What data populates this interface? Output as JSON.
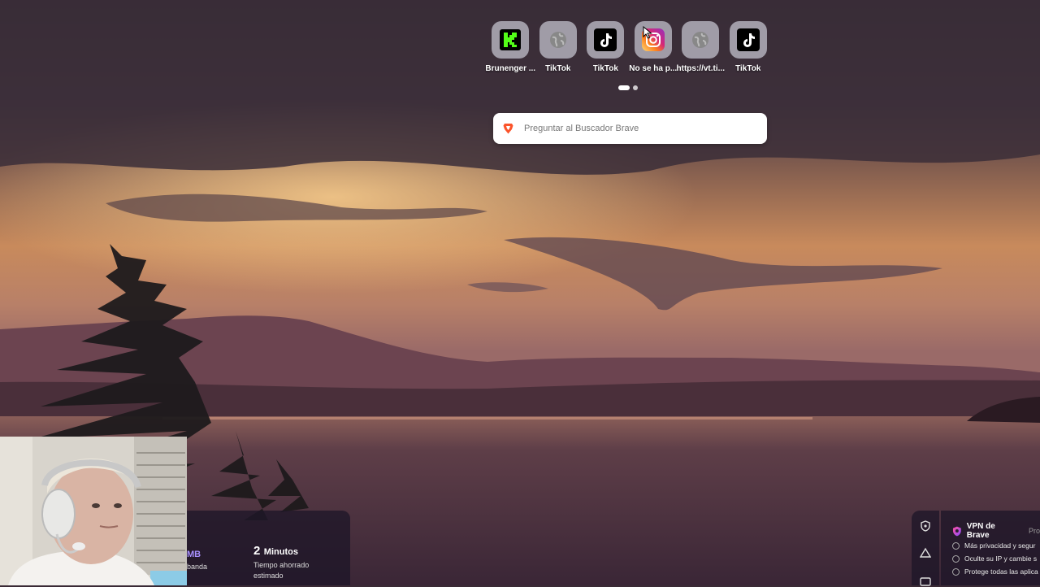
{
  "top_sites": [
    {
      "label": "Brunenger ...",
      "icon": "kick-icon"
    },
    {
      "label": "TikTok",
      "icon": "globe-icon"
    },
    {
      "label": "TikTok",
      "icon": "tiktok-icon"
    },
    {
      "label": "No se ha p...",
      "icon": "instagram-icon"
    },
    {
      "label": "https://vt.ti...",
      "icon": "globe-icon"
    },
    {
      "label": "TikTok",
      "icon": "tiktok-icon"
    }
  ],
  "search": {
    "placeholder": "Preguntar al Buscador Brave"
  },
  "stats": {
    "bandwidth_value": "MB",
    "bandwidth_label": "banda",
    "time_value": "2",
    "time_unit": "Minutos",
    "time_label": "Tiempo ahorrado estimado"
  },
  "vpn": {
    "title": "VPN de Brave",
    "badge": "Pro",
    "features": [
      "Más privacidad y segur",
      "Oculte su IP y cambie s",
      "Protege todas las aplica"
    ]
  },
  "colors": {
    "accent": "#a890ff",
    "brave": "#fb542b"
  }
}
